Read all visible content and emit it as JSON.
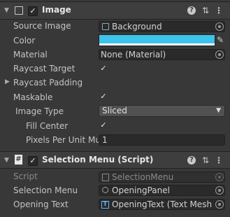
{
  "image_component": {
    "title": "Image",
    "enabled": true,
    "source_image_label": "Source Image",
    "source_image_value": "Background",
    "color_label": "Color",
    "color_value": "#3ec3ea",
    "material_label": "Material",
    "material_value": "None (Material)",
    "raycast_target_label": "Raycast Target",
    "raycast_target_checked": true,
    "raycast_padding_label": "Raycast Padding",
    "maskable_label": "Maskable",
    "maskable_checked": true,
    "image_type_label": "Image Type",
    "image_type_value": "Sliced",
    "fill_center_label": "Fill Center",
    "fill_center_checked": true,
    "ppu_label": "Pixels Per Unit Mul",
    "ppu_value": "1"
  },
  "selection_menu_component": {
    "title": "Selection Menu (Script)",
    "script_label": "Script",
    "script_value": "SelectionMenu",
    "selection_menu_label": "Selection Menu",
    "selection_menu_value": "OpeningPanel",
    "opening_text_label": "Opening Text",
    "opening_text_value": "OpeningText (Text Mesh P"
  },
  "icons": {
    "help": "?",
    "presets": "⇅",
    "more": "⋮",
    "checkmark": "✓",
    "foldout_open": "▼",
    "foldout_closed": "▶",
    "dropdown_arrow": "▼",
    "eyedropper": "✎"
  }
}
